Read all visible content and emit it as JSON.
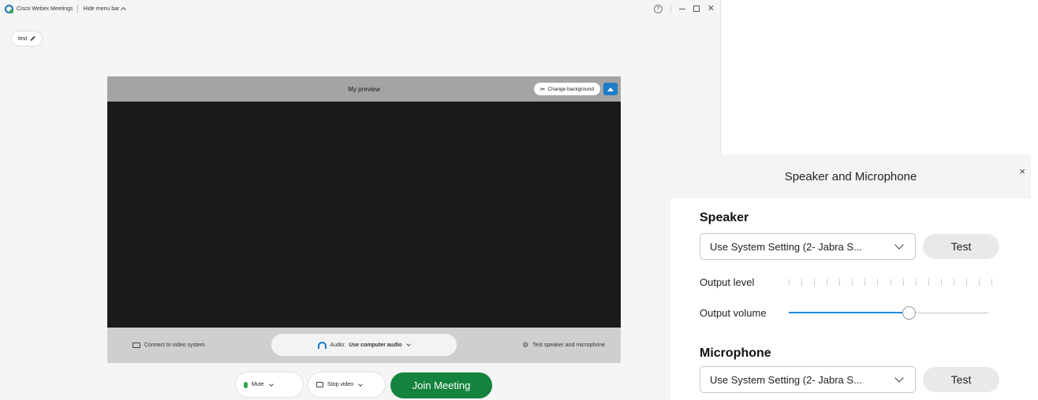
{
  "window": {
    "app_title": "Cisco Webex Meetings",
    "hide_menu_bar": "Hide menu bar",
    "help_icon": "?",
    "close_icon": "✕"
  },
  "name_tag": "test",
  "preview": {
    "title": "My preview",
    "change_background": "Change background"
  },
  "footer": {
    "connect_video": "Connect to video system",
    "audio_label": "Audio:",
    "audio_value": "Use computer audio",
    "test_speaker_mic": "Test speaker and microphone"
  },
  "controls": {
    "mute": "Mute",
    "stop_video": "Stop video",
    "join": "Join Meeting"
  },
  "speaker_mic_panel": {
    "title": "Speaker and Microphone",
    "close": "×",
    "speaker_heading": "Speaker",
    "speaker_select": "Use System Setting (2- Jabra S...",
    "speaker_test": "Test",
    "output_level_label": "Output level",
    "output_volume_label": "Output volume",
    "output_volume_fraction": 0.6,
    "microphone_heading": "Microphone",
    "microphone_select": "Use System Setting (2- Jabra S...",
    "microphone_test": "Test"
  },
  "colors": {
    "accent_blue": "#1c7cc7",
    "join_green": "#14833d",
    "slider_blue": "#1f8ae0"
  }
}
